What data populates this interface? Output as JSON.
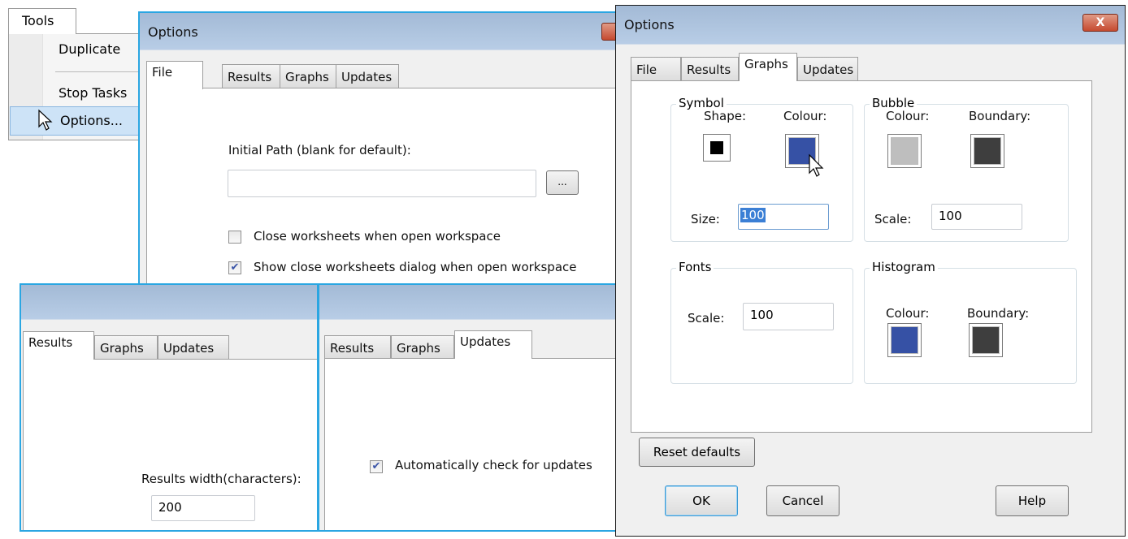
{
  "tools_menu": {
    "title": "Tools",
    "items": [
      {
        "label": "Duplicate"
      },
      {
        "label": "Stop Tasks"
      },
      {
        "label": "Options..."
      }
    ]
  },
  "file_dialog": {
    "title": "Options",
    "tabs": [
      "File",
      "Results",
      "Graphs",
      "Updates"
    ],
    "active_tab": "File",
    "initial_path_label": "Initial Path (blank for default):",
    "initial_path_value": "",
    "browse_label": "...",
    "checkboxes": [
      {
        "label": "Close worksheets when open workspace",
        "checked": false
      },
      {
        "label": "Show close worksheets dialog when open workspace",
        "checked": true
      }
    ]
  },
  "results_dialog": {
    "tabs": [
      "Results",
      "Graphs",
      "Updates"
    ],
    "active_tab": "Results",
    "width_label": "Results width(characters):",
    "width_value": "200"
  },
  "updates_dialog": {
    "tabs": [
      "Results",
      "Graphs",
      "Updates"
    ],
    "active_tab": "Updates",
    "checkbox": {
      "label": "Automatically check for updates",
      "checked": true
    }
  },
  "graphs_dialog": {
    "title": "Options",
    "close_label": "X",
    "tabs": [
      "File",
      "Results",
      "Graphs",
      "Updates"
    ],
    "active_tab": "Graphs",
    "symbol": {
      "title": "Symbol",
      "shape_label": "Shape:",
      "colour_label": "Colour:",
      "shape_color": "#000000",
      "colour": "#3651a5",
      "size_label": "Size:",
      "size_value": "100"
    },
    "bubble": {
      "title": "Bubble",
      "colour_label": "Colour:",
      "boundary_label": "Boundary:",
      "colour": "#bebebe",
      "boundary": "#3e3e3e",
      "scale_label": "Scale:",
      "scale_value": "100"
    },
    "fonts": {
      "title": "Fonts",
      "scale_label": "Scale:",
      "scale_value": "100"
    },
    "histogram": {
      "title": "Histogram",
      "colour_label": "Colour:",
      "boundary_label": "Boundary:",
      "colour": "#3651a5",
      "boundary": "#3e3e3e"
    },
    "reset_label": "Reset defaults",
    "ok_label": "OK",
    "cancel_label": "Cancel",
    "help_label": "Help"
  }
}
